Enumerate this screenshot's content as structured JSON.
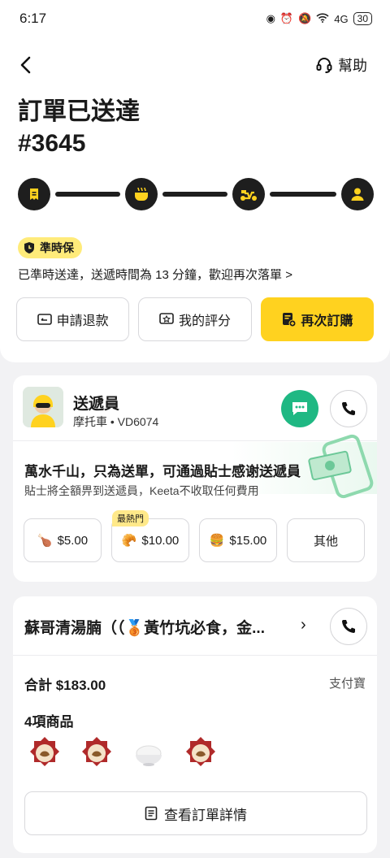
{
  "status_bar": {
    "time": "6:17",
    "network": "4G",
    "battery": "30"
  },
  "nav": {
    "help_label": "幫助"
  },
  "order": {
    "title": "訂單已送達",
    "number": "#3645"
  },
  "progress": {
    "steps": [
      "receipt-icon",
      "food-icon",
      "scooter-icon",
      "user-icon"
    ]
  },
  "ontime": {
    "badge": "準時保",
    "message": "已準時送達，送遞時間為 13 分鐘，歡迎再次落單 >"
  },
  "actions": {
    "refund": "申請退款",
    "review": "我的評分",
    "reorder": "再次訂購"
  },
  "courier": {
    "title": "送遞員",
    "subtitle": "摩托車 • VD6074",
    "tip_title": "萬水千山，只為送單，可通過貼士感谢送遞員",
    "tip_subtitle": "貼士將全額畀到送遞員，Keeta不收取任何費用",
    "tips": [
      {
        "icon": "🍗",
        "amount": "$5.00"
      },
      {
        "icon": "🥐",
        "amount": "$10.00",
        "tag": "最熱門"
      },
      {
        "icon": "🍔",
        "amount": "$15.00"
      },
      {
        "icon": "",
        "amount": "其他"
      }
    ]
  },
  "store": {
    "name": "蘇哥清湯腩（（🥉黃竹坑必食，金...",
    "total": "合計 $183.00",
    "payment": "支付寶",
    "items_count": "4項商品",
    "view_details": "查看訂單詳情"
  },
  "colors": {
    "accent_yellow": "#ffd21f",
    "chat_green": "#1fb883",
    "dark": "#1e1e1e"
  }
}
